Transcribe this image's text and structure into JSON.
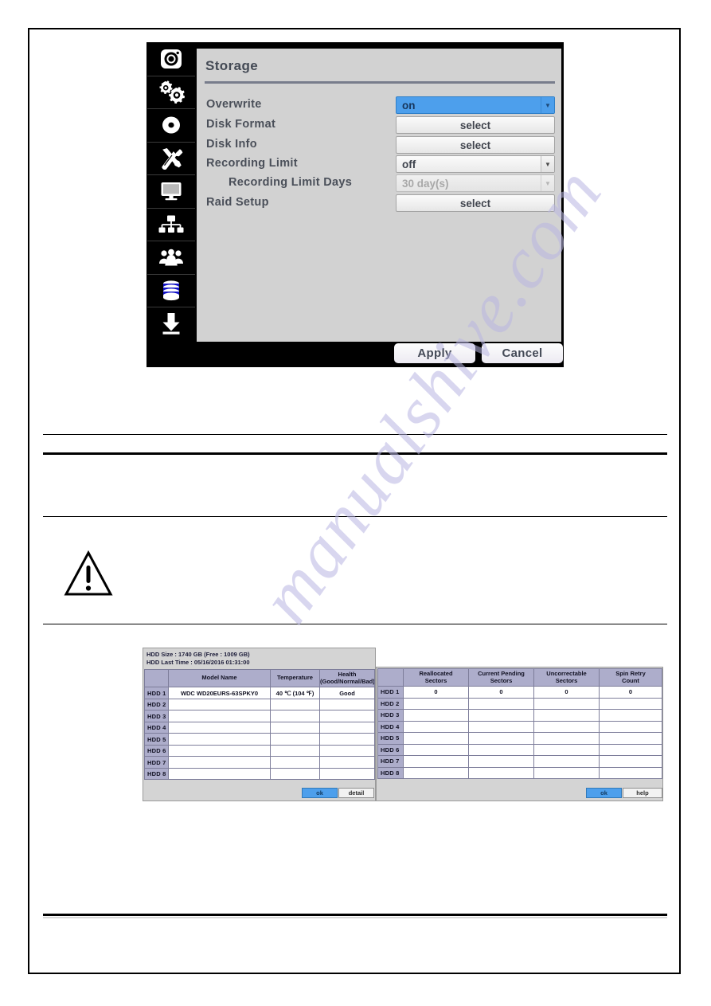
{
  "dialog": {
    "title": "Storage",
    "sidebar": {
      "items": [
        {
          "name": "camera-icon",
          "label": "Camera",
          "active": false
        },
        {
          "name": "system-settings-icon",
          "label": "System",
          "active": false
        },
        {
          "name": "record-disc-icon",
          "label": "Record",
          "active": false
        },
        {
          "name": "tools-icon",
          "label": "Device",
          "active": false
        },
        {
          "name": "monitor-icon",
          "label": "Display",
          "active": false
        },
        {
          "name": "network-icon",
          "label": "Network",
          "active": false
        },
        {
          "name": "users-icon",
          "label": "User",
          "active": false
        },
        {
          "name": "database-icon",
          "label": "Storage",
          "active": true
        },
        {
          "name": "download-icon",
          "label": "Backup",
          "active": false
        }
      ]
    },
    "rows": [
      {
        "label": "Overwrite",
        "control": "combo",
        "value": "on",
        "state": "selected",
        "indent": false
      },
      {
        "label": "Disk  Format",
        "control": "button",
        "value": "select",
        "state": "normal",
        "indent": false
      },
      {
        "label": "Disk  Info",
        "control": "button",
        "value": "select",
        "state": "normal",
        "indent": false
      },
      {
        "label": "Recording  Limit",
        "control": "combo",
        "value": "off",
        "state": "normal",
        "indent": false
      },
      {
        "label": "Recording  Limit  Days",
        "control": "combo",
        "value": "30  day(s)",
        "state": "disabled",
        "indent": true
      },
      {
        "label": "Raid  Setup",
        "control": "button",
        "value": "select",
        "state": "normal",
        "indent": false
      }
    ],
    "footer": {
      "apply_label": "Apply",
      "cancel_label": "Cancel"
    },
    "colors": {
      "accent_blue": "#4d9fec",
      "panel_gray": "#d2d2d2",
      "chrome_black": "#000000",
      "title_text": "#444a55"
    }
  },
  "hdd_left": {
    "summary_size": "HDD Size : 1740 GB (Free : 1009 GB)",
    "summary_time": "HDD Last Time : 05/16/2016 01:31:00",
    "columns": [
      "",
      "Model Name",
      "Temperature",
      "Health\n(Good/Normal/Bad)"
    ],
    "columns_display": [
      {
        "line1": "",
        "line2": ""
      },
      {
        "line1": "Model  Name",
        "line2": ""
      },
      {
        "line1": "Temperature",
        "line2": ""
      },
      {
        "line1": "Health",
        "line2": "(Good/Normal/Bad)"
      }
    ],
    "rows": [
      {
        "id": "HDD 1",
        "model": "WDC  WD20EURS-63SPKY0",
        "temperature": "40 ℃ (104 ℉)",
        "health": "Good"
      },
      {
        "id": "HDD 2",
        "model": "",
        "temperature": "",
        "health": ""
      },
      {
        "id": "HDD 3",
        "model": "",
        "temperature": "",
        "health": ""
      },
      {
        "id": "HDD 4",
        "model": "",
        "temperature": "",
        "health": ""
      },
      {
        "id": "HDD 5",
        "model": "",
        "temperature": "",
        "health": ""
      },
      {
        "id": "HDD 6",
        "model": "",
        "temperature": "",
        "health": ""
      },
      {
        "id": "HDD 7",
        "model": "",
        "temperature": "",
        "health": ""
      },
      {
        "id": "HDD 8",
        "model": "",
        "temperature": "",
        "health": ""
      }
    ],
    "buttons": {
      "ok_label": "ok",
      "secondary_label": "detail"
    }
  },
  "hdd_right": {
    "columns_display": [
      {
        "line1": "",
        "line2": ""
      },
      {
        "line1": "Reallocated",
        "line2": "Sectors"
      },
      {
        "line1": "Current  Pending",
        "line2": "Sectors"
      },
      {
        "line1": "Uncorrectable",
        "line2": "Sectors"
      },
      {
        "line1": "Spin  Retry",
        "line2": "Count"
      }
    ],
    "rows": [
      {
        "id": "HDD 1",
        "reallocated": "0",
        "pending": "0",
        "uncorrectable": "0",
        "spin_retry": "0"
      },
      {
        "id": "HDD 2",
        "reallocated": "",
        "pending": "",
        "uncorrectable": "",
        "spin_retry": ""
      },
      {
        "id": "HDD 3",
        "reallocated": "",
        "pending": "",
        "uncorrectable": "",
        "spin_retry": ""
      },
      {
        "id": "HDD 4",
        "reallocated": "",
        "pending": "",
        "uncorrectable": "",
        "spin_retry": ""
      },
      {
        "id": "HDD 5",
        "reallocated": "",
        "pending": "",
        "uncorrectable": "",
        "spin_retry": ""
      },
      {
        "id": "HDD 6",
        "reallocated": "",
        "pending": "",
        "uncorrectable": "",
        "spin_retry": ""
      },
      {
        "id": "HDD 7",
        "reallocated": "",
        "pending": "",
        "uncorrectable": "",
        "spin_retry": ""
      },
      {
        "id": "HDD 8",
        "reallocated": "",
        "pending": "",
        "uncorrectable": "",
        "spin_retry": ""
      }
    ],
    "buttons": {
      "ok_label": "ok",
      "secondary_label": "help"
    }
  },
  "page": {
    "watermark_text": "manualshive.com",
    "warning_icon": "warning-triangle-icon"
  }
}
